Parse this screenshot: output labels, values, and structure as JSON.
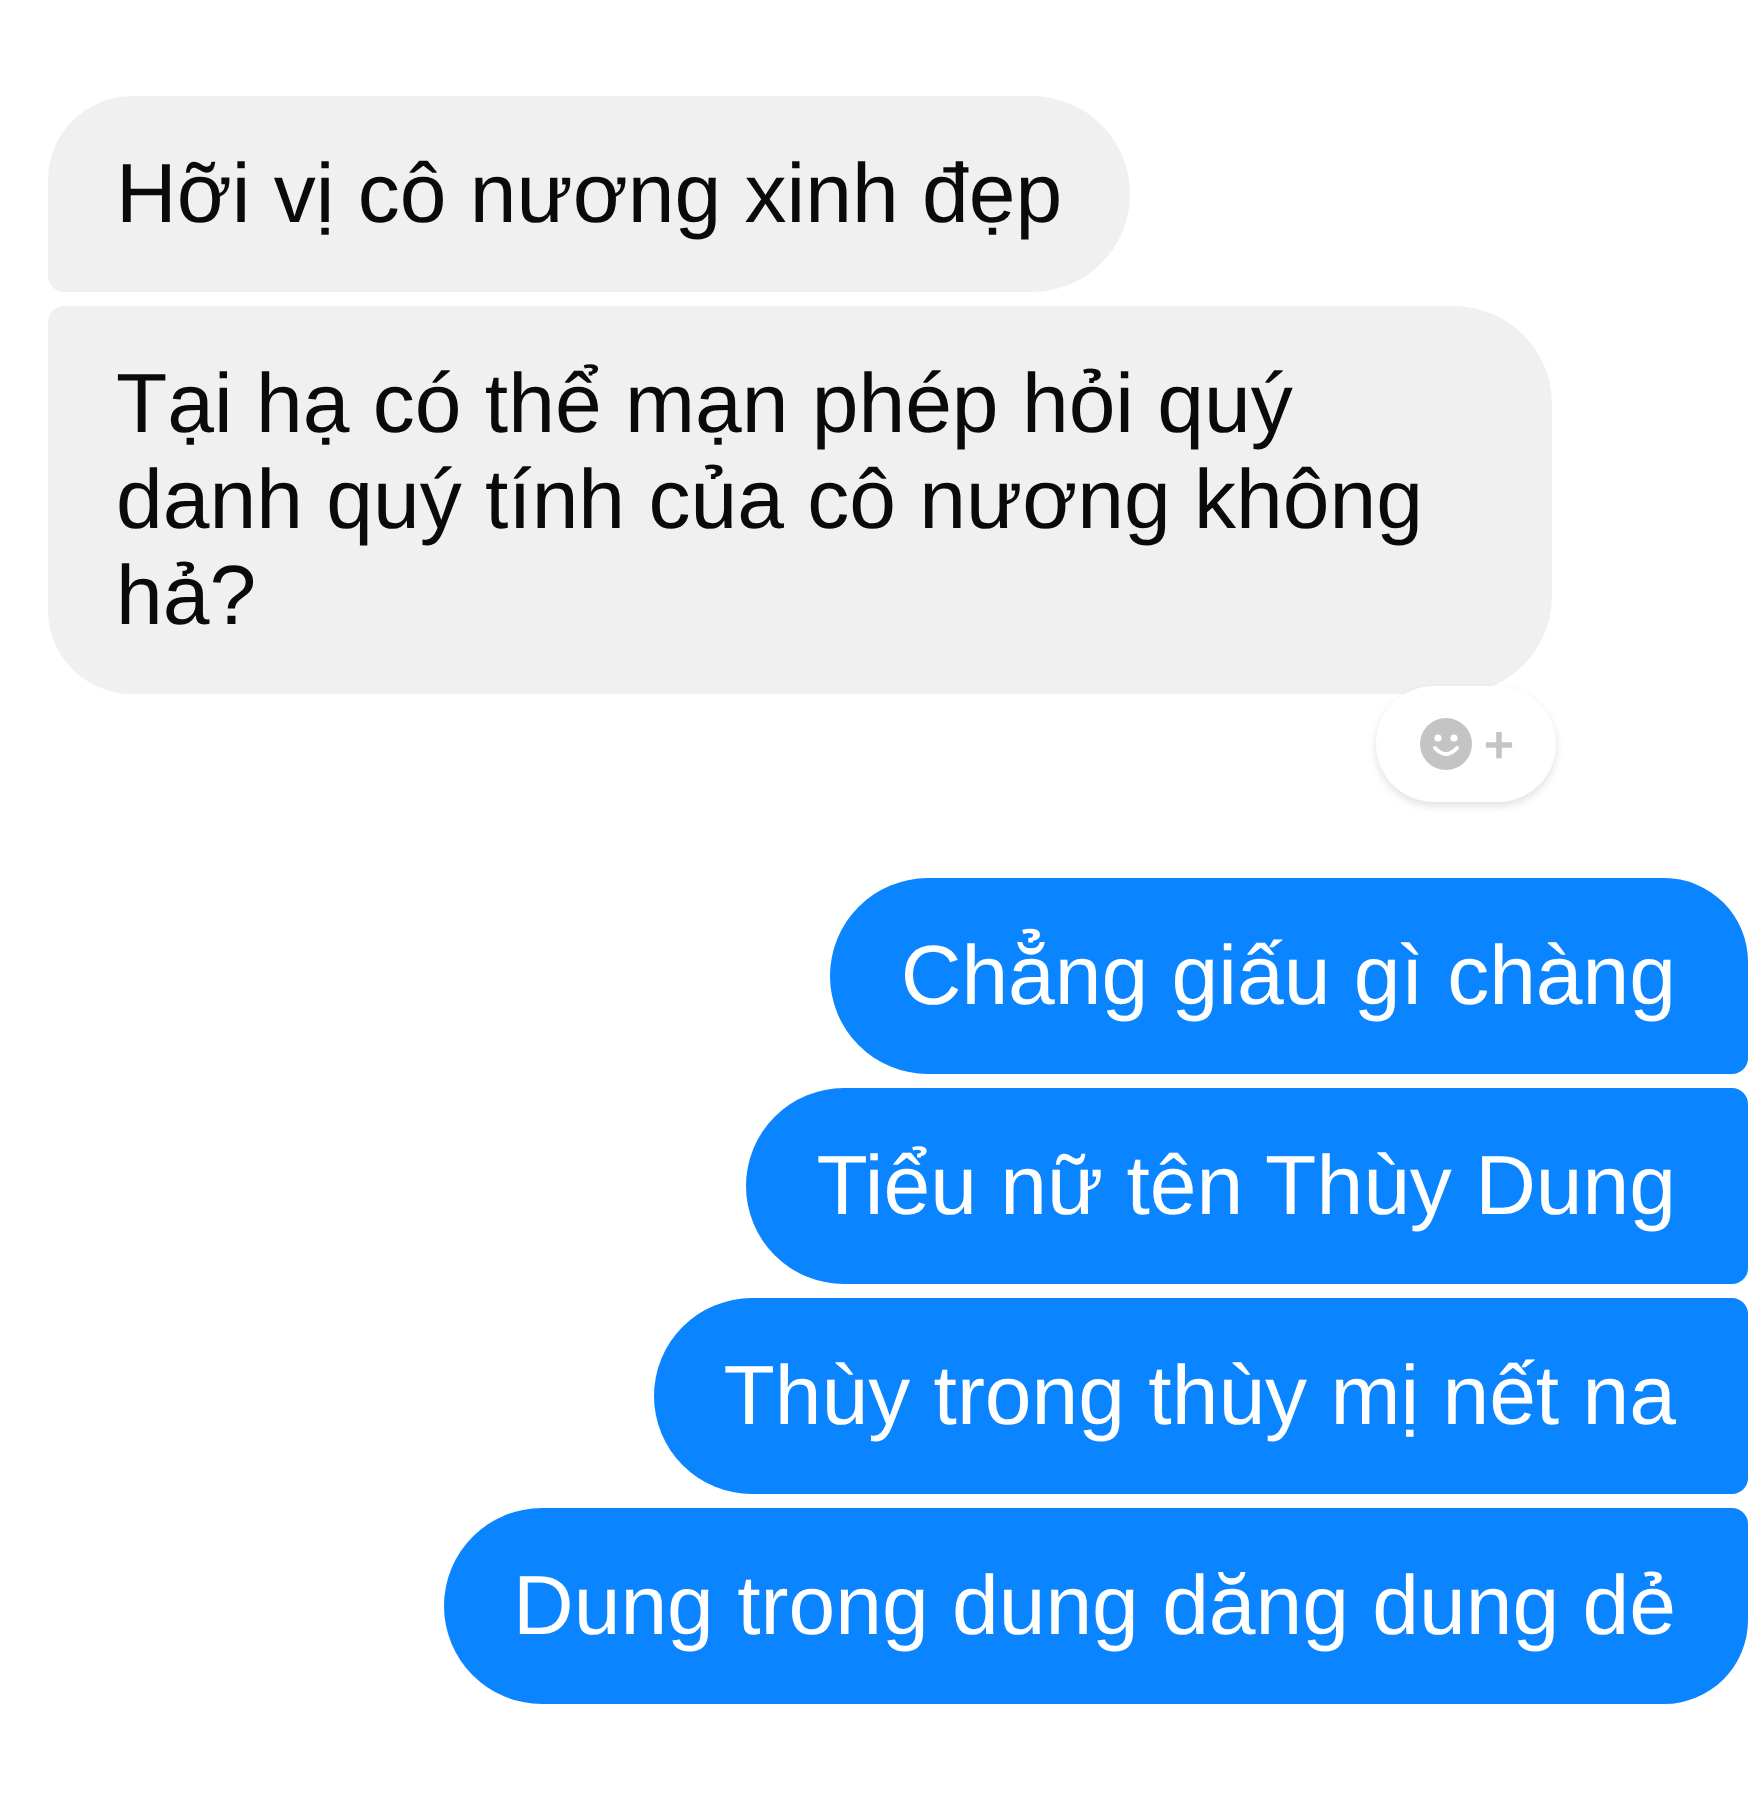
{
  "messages": [
    {
      "kind": "received",
      "text": "Hỡi vị cô nương xinh đẹp",
      "add_reaction": false
    },
    {
      "kind": "received",
      "text": "Tại hạ có thể mạn phép hỏi quý danh quý tính của cô nương không hả?",
      "add_reaction": true
    },
    {
      "kind": "sent",
      "text": "Chẳng giấu gì chàng",
      "add_reaction": false
    },
    {
      "kind": "sent",
      "text": "Tiểu nữ tên Thùy Dung",
      "add_reaction": false
    },
    {
      "kind": "sent",
      "text": "Thùy trong thùy mị nết na",
      "add_reaction": false
    },
    {
      "kind": "sent",
      "text": "Dung trong dung dăng dung dẻ",
      "add_reaction": false
    }
  ]
}
